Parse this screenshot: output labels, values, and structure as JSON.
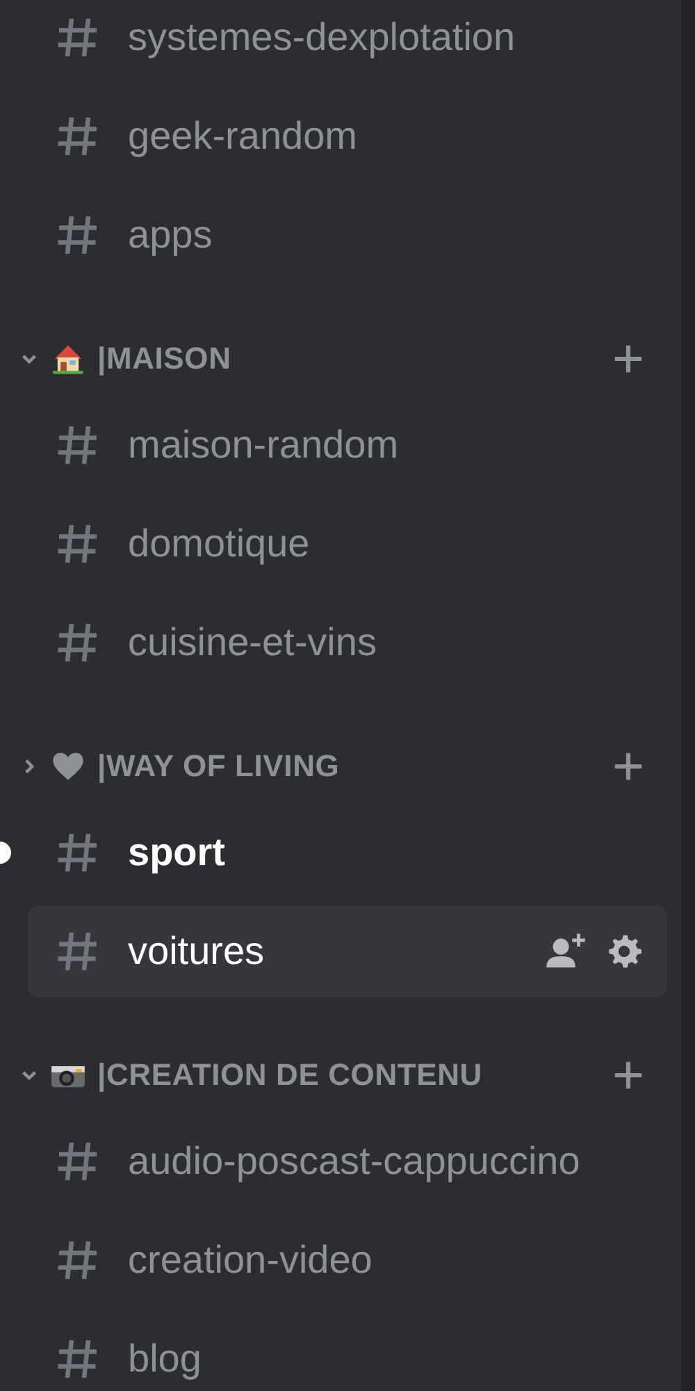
{
  "groups": [
    {
      "channels": [
        {
          "name": "systemes-dexplotation",
          "unread": false,
          "selected": false
        },
        {
          "name": "geek-random",
          "unread": false,
          "selected": false
        },
        {
          "name": "apps",
          "unread": false,
          "selected": false
        }
      ]
    },
    {
      "category": {
        "name": "|MAISON",
        "expanded": true
      },
      "channels": [
        {
          "name": "maison-random",
          "unread": false,
          "selected": false
        },
        {
          "name": "domotique",
          "unread": false,
          "selected": false
        },
        {
          "name": "cuisine-et-vins",
          "unread": false,
          "selected": false
        }
      ]
    },
    {
      "category": {
        "name": "|WAY OF LIVING",
        "expanded": false
      },
      "channels": [
        {
          "name": "sport",
          "unread": true,
          "selected": false
        },
        {
          "name": "voitures",
          "unread": false,
          "selected": true
        }
      ]
    },
    {
      "category": {
        "name": "|CREATION DE CONTENU",
        "expanded": true
      },
      "channels": [
        {
          "name": "audio-poscast-cappuccino",
          "unread": false,
          "selected": false
        },
        {
          "name": "creation-video",
          "unread": false,
          "selected": false
        },
        {
          "name": "blog",
          "unread": false,
          "selected": false
        }
      ]
    }
  ]
}
